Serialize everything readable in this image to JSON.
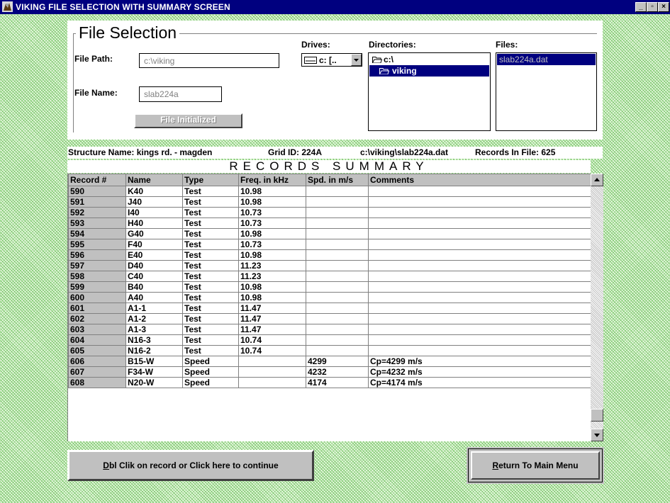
{
  "window": {
    "title": "VIKING FILE SELECTION WITH SUMMARY SCREEN",
    "controls": [
      "_",
      "▫",
      "×"
    ]
  },
  "file_selection": {
    "legend": "File Selection",
    "file_path_label": "File Path:",
    "file_path_value": "c:\\viking",
    "file_name_label": "File Name:",
    "file_name_value": "slab224a",
    "file_initialized_button": "File Initialized",
    "drives_label": "Drives:",
    "drive_value": "c: [..",
    "directories_label": "Directories:",
    "directories": [
      "c:\\",
      "viking"
    ],
    "directories_selected_index": 1,
    "files_label": "Files:",
    "files": [
      "slab224a.dat"
    ]
  },
  "info": {
    "structure": "Structure Name: kings rd. - magden",
    "grid_id": "Grid ID: 224A",
    "path": "c:\\viking\\slab224a.dat",
    "records_count": "Records In File: 625"
  },
  "summary": {
    "title": "RECORDS SUMMARY",
    "columns": [
      "Record #",
      "Name",
      "Type",
      "Freq. in kHz",
      "Spd. in m/s",
      "Comments"
    ],
    "rows": [
      [
        "590",
        "K40",
        "Test",
        "10.98",
        "",
        ""
      ],
      [
        "591",
        "J40",
        "Test",
        "10.98",
        "",
        ""
      ],
      [
        "592",
        "I40",
        "Test",
        "10.73",
        "",
        ""
      ],
      [
        "593",
        "H40",
        "Test",
        "10.73",
        "",
        ""
      ],
      [
        "594",
        "G40",
        "Test",
        "10.98",
        "",
        ""
      ],
      [
        "595",
        "F40",
        "Test",
        "10.73",
        "",
        ""
      ],
      [
        "596",
        "E40",
        "Test",
        "10.98",
        "",
        ""
      ],
      [
        "597",
        "D40",
        "Test",
        "11.23",
        "",
        ""
      ],
      [
        "598",
        "C40",
        "Test",
        "11.23",
        "",
        ""
      ],
      [
        "599",
        "B40",
        "Test",
        "10.98",
        "",
        ""
      ],
      [
        "600",
        "A40",
        "Test",
        "10.98",
        "",
        ""
      ],
      [
        "601",
        "A1-1",
        "Test",
        "11.47",
        "",
        ""
      ],
      [
        "602",
        "A1-2",
        "Test",
        "11.47",
        "",
        ""
      ],
      [
        "603",
        "A1-3",
        "Test",
        "11.47",
        "",
        ""
      ],
      [
        "604",
        "N16-3",
        "Test",
        "10.74",
        "",
        ""
      ],
      [
        "605",
        "N16-2",
        "Test",
        "10.74",
        "",
        ""
      ],
      [
        "606",
        "B15-W",
        "Speed",
        "",
        "4299",
        "Cp=4299 m/s"
      ],
      [
        "607",
        "F34-W",
        "Speed",
        "",
        "4232",
        "Cp=4232 m/s"
      ],
      [
        "608",
        "N20-W",
        "Speed",
        "",
        "4174",
        "Cp=4174 m/s"
      ]
    ]
  },
  "buttons": {
    "continue": "Dbl Clik on record or Click here to continue",
    "return": "Return To Main Menu"
  }
}
